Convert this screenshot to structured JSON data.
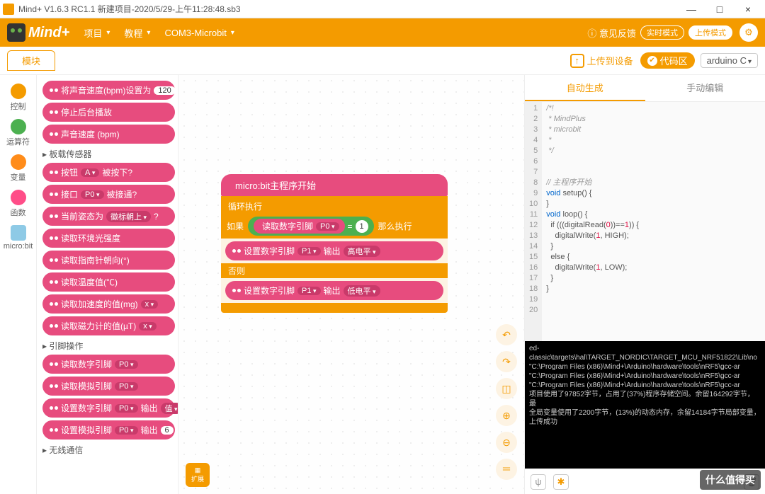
{
  "title": "Mind+ V1.6.3 RC1.1    新建项目-2020/5/29-上午11:28:48.sb3",
  "win": {
    "min": "—",
    "max": "□",
    "close": "×"
  },
  "logo": "Mind+",
  "menu": {
    "project": "项目",
    "tutorial": "教程",
    "port": "COM3-Microbit"
  },
  "feedback": "意见反馈",
  "mode": {
    "realtime": "实时模式",
    "upload": "上传模式"
  },
  "modtab": "模块",
  "upload": "上传到设备",
  "codearea": "代码区",
  "lang": "arduino C",
  "cats": [
    {
      "label": "控制",
      "color": "#f49b00"
    },
    {
      "label": "运算符",
      "color": "#4cb050"
    },
    {
      "label": "变量",
      "color": "#ff8c1a"
    },
    {
      "label": "函数",
      "color": "#ff4d88"
    },
    {
      "label": "micro:bit",
      "color": "#8ecae6"
    }
  ],
  "palette": {
    "b1": "将声音速度(bpm)设置为",
    "b1v": "120",
    "b2": "停止后台播放",
    "b3": "声音速度 (bpm)",
    "h1": "板载传感器",
    "b4": "按钮",
    "b4a": "A",
    "b4b": "被按下?",
    "b5": "接口",
    "b5a": "P0",
    "b5b": "被接通?",
    "b6": "当前姿态为",
    "b6a": "徽标朝上",
    "b6b": "?",
    "b7": "读取环境光强度",
    "b8": "读取指南针朝向(°)",
    "b9": "读取温度值(℃)",
    "b10": "读取加速度的值(mg)",
    "b10a": "x",
    "b11": "读取磁力计的值(µT)",
    "b11a": "x",
    "h2": "引脚操作",
    "b12": "读取数字引脚",
    "b12a": "P0",
    "b13": "读取模拟引脚",
    "b13a": "P0",
    "b14": "设置数字引脚",
    "b14a": "P0",
    "b14b": "输出",
    "b14c": "值",
    "b15": "设置模拟引脚",
    "b15a": "P0",
    "b15b": "输出",
    "b15c": "6",
    "h3": "无线通信"
  },
  "stack": {
    "hat": "micro:bit主程序开始",
    "loop": "循环执行",
    "if": "如果",
    "then": "那么执行",
    "else": "否则",
    "read": "读取数字引脚",
    "readp": "P0",
    "eq": "=",
    "one": "1",
    "set": "设置数字引脚",
    "p1": "P1",
    "out": "输出",
    "hi": "高电平",
    "lo": "低电平"
  },
  "rtabs": {
    "auto": "自动生成",
    "manual": "手动编辑"
  },
  "code": {
    "lines": [
      "1",
      "2",
      "3",
      "4",
      "5",
      "6",
      "7",
      "8",
      "9",
      "10",
      "11",
      "12",
      "13",
      "14",
      "15",
      "16",
      "17",
      "18",
      "19",
      "20"
    ]
  },
  "src": {
    "l1": "/*!",
    "l2": " * MindPlus",
    "l3": " * microbit",
    "l4": " *",
    "l5": " */",
    "l6": "",
    "l7": "",
    "l8": "// 主程序开始",
    "l9a": "void",
    "l9b": " setup() {",
    "l10": "}",
    "l11a": "void",
    "l11b": " loop() {",
    "l12a": "  if (((digitalRead(",
    "l12b": "0",
    "l12c": "))==",
    "l12d": "1",
    "l12e": ")) {",
    "l13a": "    digitalWrite(",
    "l13b": "1",
    "l13c": ", HIGH);",
    "l14": "  }",
    "l15": "  else {",
    "l16a": "    digitalWrite(",
    "l16b": "1",
    "l16c": ", LOW);",
    "l17": "  }",
    "l18": "}"
  },
  "console": {
    "l1": "ed-classic\\targets\\hal\\TARGET_NORDIC\\TARGET_MCU_NRF51822\\Lib\\no",
    "l2": "\"C:\\Program Files (x86)\\Mind+\\Arduino\\hardware\\tools\\nRF5\\gcc-ar",
    "l3": "\"C:\\Program Files (x86)\\Mind+\\Arduino\\hardware\\tools\\nRF5\\gcc-ar",
    "l4": "\"C:\\Program Files (x86)\\Mind+\\Arduino\\hardware\\tools\\nRF5\\gcc-ar",
    "l5": "项目使用了97852字节，占用了(37%)程序存储空间。余留164292字节，最",
    "l6": "全局变量使用了2200字节，(13%)的动态内存，余留14184字节局部变量，",
    "l7": "上传成功"
  },
  "ext": "扩展",
  "watermark": "什么值得买"
}
